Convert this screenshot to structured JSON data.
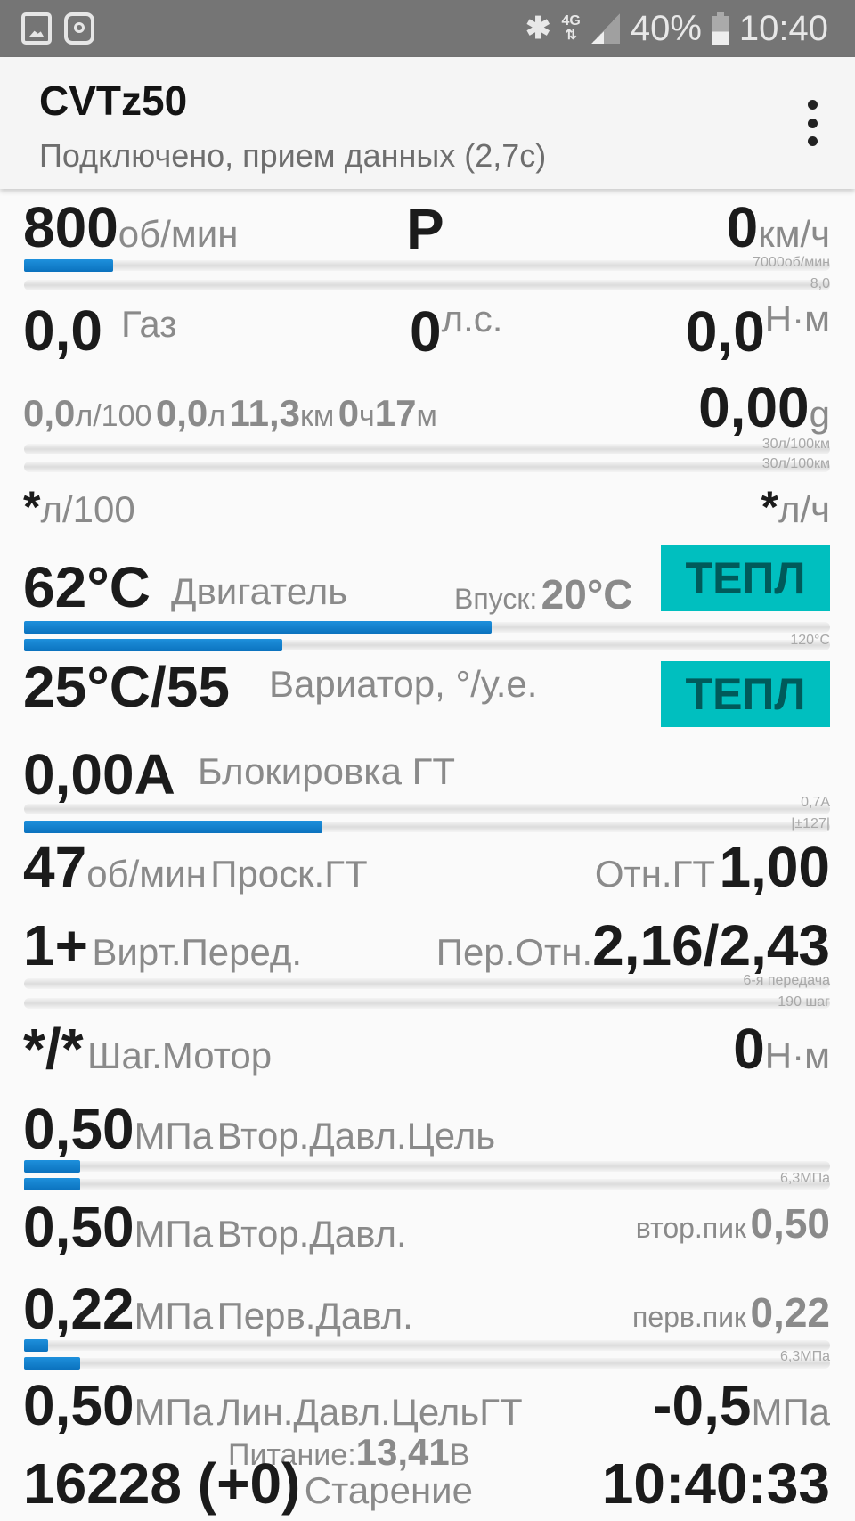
{
  "status_bar": {
    "left_icons": [
      "gallery-icon",
      "instagram-icon"
    ],
    "bluetooth": "✱",
    "network": "4G",
    "battery_percent": "40%",
    "time": "10:40"
  },
  "app_bar": {
    "title": "CVTz50",
    "subtitle": "Подключено, прием данных (2,7с)",
    "menu_icon": "more-vert-icon"
  },
  "rows": {
    "rpm": {
      "value": "800",
      "unit": "об/мин",
      "gear": "P",
      "speed_value": "0",
      "speed_unit": "км/ч",
      "bar1_max": "7000об/мин",
      "bar2_max": "8,0",
      "bar1_fraction": 0.11,
      "bar2_fraction": 0.0
    },
    "throttle": {
      "value": "0,0",
      "label": "Газ",
      "hp_value": "0",
      "hp_unit": "л.с.",
      "torque_value": "0,0",
      "torque_unit": "Н·м"
    },
    "consumption": {
      "avg_value": "0,0",
      "avg_unit": "л/100",
      "fuel_value": "0,0",
      "fuel_unit": "л",
      "dist_value": "11,3",
      "dist_unit": "км",
      "hours_value": "0",
      "hours_unit": "ч",
      "min_value": "17",
      "min_unit": "м",
      "g_value": "0,00",
      "g_unit": "g",
      "bar1_max": "30л/100км",
      "bar2_max": "30л/100км",
      "bar1_fraction": 0.0,
      "bar2_fraction": 0.0
    },
    "instant": {
      "l100_value": "*",
      "l100_unit": "л/100",
      "lh_value": "*",
      "lh_unit": "л/ч"
    },
    "engine": {
      "value": "62°C",
      "label": "Двигатель",
      "intake_label": "Впуск:",
      "intake_value": "20°C",
      "badge": "ТЕПЛ",
      "bar_max": "120°C",
      "bar1_fraction": 0.58,
      "bar2_fraction": 0.32
    },
    "cvt": {
      "value": "25°C/55",
      "label": "Вариатор, °/у.е.",
      "badge": "ТЕПЛ"
    },
    "lockup": {
      "value": "0,00A",
      "label": "Блокировка ГТ",
      "bar1_max": "0,7A",
      "bar2_max": "|±127|",
      "bar1_fraction": 0.0,
      "bar2_fraction": 0.37
    },
    "slip": {
      "value": "47",
      "unit": "об/мин",
      "label": "Проск.ГТ",
      "ratio_label": "Отн.ГТ",
      "ratio_value": "1,00"
    },
    "virtual_gear": {
      "value": "1+",
      "label": "Вирт.Перед.",
      "ratio_label": "Пер.Отн.",
      "ratio_value": "2,16/2,43",
      "bar1_max": "6-я передача",
      "bar2_max": "190 шаг",
      "bar1_fraction": 0.0,
      "bar2_fraction": 0.0
    },
    "step_motor": {
      "value": "*/*",
      "label": "Шаг.Мотор",
      "torque_value": "0",
      "torque_unit": "Н·м"
    },
    "sec_target": {
      "value": "0,50",
      "unit": "МПа",
      "label": "Втор.Давл.Цель",
      "bar_max": "6,3МПа",
      "bar1_fraction": 0.07,
      "bar2_fraction": 0.07
    },
    "sec_pressure": {
      "value": "0,50",
      "unit": "МПа",
      "label": "Втор.Давл.",
      "peak_label": "втор.пик",
      "peak_value": "0,50"
    },
    "pri_pressure": {
      "value": "0,22",
      "unit": "МПа",
      "label": "Перв.Давл.",
      "peak_label": "перв.пик",
      "peak_value": "0,22",
      "bar_max": "6,3МПа",
      "bar1_fraction": 0.03,
      "bar2_fraction": 0.07
    },
    "line_target": {
      "value": "0,50",
      "unit": "МПа",
      "label": "Лин.Давл.ЦельГТ",
      "gt_value": "-0,5",
      "gt_unit": "МПа"
    },
    "supply": {
      "label": "Питание:",
      "value": "13,41",
      "unit": "В"
    },
    "aging": {
      "value": "16228 (+0)",
      "label": "Старение",
      "clock": "10:40:33"
    }
  },
  "colors": {
    "accent_bar": "#1582cc",
    "badge_bg": "#00bfbf",
    "badge_text": "#005a5a",
    "status_bar_bg": "#757575"
  }
}
